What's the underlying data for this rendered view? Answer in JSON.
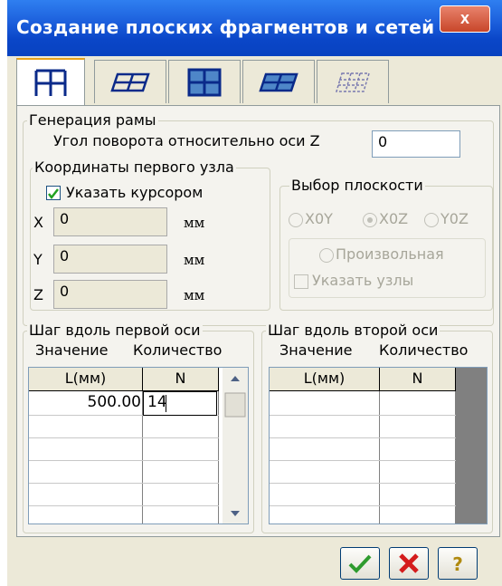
{
  "window": {
    "title": "Создание плоских фрагментов и сетей",
    "close_label": "x"
  },
  "tabs": [
    {
      "icon": "frame-grid-icon",
      "active": true
    },
    {
      "icon": "horizontal-grid-icon",
      "active": false
    },
    {
      "icon": "plate-grid-icon",
      "active": false
    },
    {
      "icon": "skewed-plate-grid-icon",
      "active": false
    },
    {
      "icon": "dashed-grid-icon",
      "active": false
    }
  ],
  "frame_generation": {
    "title": "Генерация рамы",
    "rotation_label": "Угол поворота относительно оси Z",
    "rotation_value": "0"
  },
  "first_node": {
    "title": "Координаты первого узла",
    "cursor_checkbox_label": "Указать курсором",
    "cursor_checked": true,
    "x_label": "X",
    "x_value": "0",
    "y_label": "Y",
    "y_value": "0",
    "z_label": "Z",
    "z_value": "0",
    "unit": "мм"
  },
  "plane_select": {
    "title": "Выбор плоскости",
    "option_xoy": "X0Y",
    "option_xoz": "X0Z",
    "option_yoz": "Y0Z",
    "selected": "X0Z",
    "arbitrary_label": "Произвольная",
    "specify_nodes_label": "Указать узлы"
  },
  "first_axis": {
    "title": "Шаг вдоль первой оси",
    "value_label": "Значение",
    "count_label": "Количество",
    "col_l": "L(мм)",
    "col_n": "N",
    "rows": [
      {
        "l": "500.00",
        "n": "14"
      }
    ]
  },
  "second_axis": {
    "title": "Шаг вдоль второй оси",
    "value_label": "Значение",
    "count_label": "Количество",
    "col_l": "L(мм)",
    "col_n": "N",
    "rows": []
  },
  "buttons": {
    "ok_icon": "checkmark-icon",
    "cancel_icon": "red-x-icon",
    "help_label": "?"
  },
  "colors": {
    "accent": "#0a46c8",
    "ok": "#2e9b2e",
    "cancel": "#d41c1c",
    "help": "#b08a10"
  }
}
